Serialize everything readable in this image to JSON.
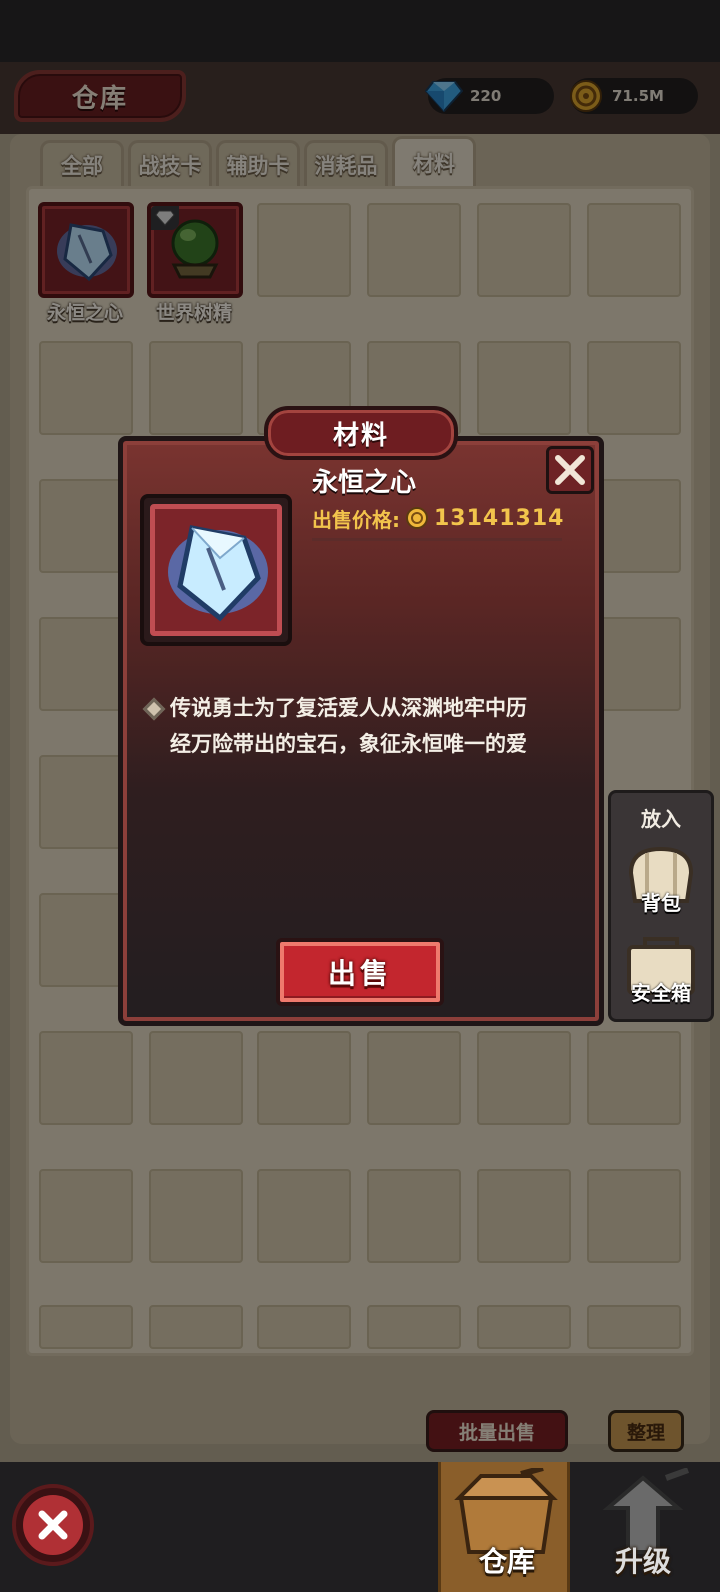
{
  "header": {
    "title": "仓库",
    "gems": "220",
    "gold": "71.5M"
  },
  "tabs": [
    {
      "label": "全部"
    },
    {
      "label": "战技卡"
    },
    {
      "label": "辅助卡"
    },
    {
      "label": "消耗品"
    },
    {
      "label": "材料",
      "active": true
    }
  ],
  "items": [
    {
      "name": "永恒之心",
      "icon": "crystal-heart-icon"
    },
    {
      "name": "世界树精",
      "icon": "green-orb-icon",
      "badge": "diamond-icon"
    }
  ],
  "actions": {
    "batch_sell": "批量出售",
    "sort": "整理"
  },
  "side_panel": {
    "title": "放入",
    "backpack": "背包",
    "safe_box": "安全箱"
  },
  "dialog": {
    "category": "材料",
    "item_name": "永恒之心",
    "price_label": "出售价格:",
    "price_value": "13141314",
    "desc_line1": "传说勇士为了复活爱人从深渊地牢中历",
    "desc_line2": "经万险带出的宝石，象征永恒唯一的爱",
    "sell_label": "出售"
  },
  "bottom_nav": {
    "warehouse": "仓库",
    "upgrade": "升级"
  }
}
